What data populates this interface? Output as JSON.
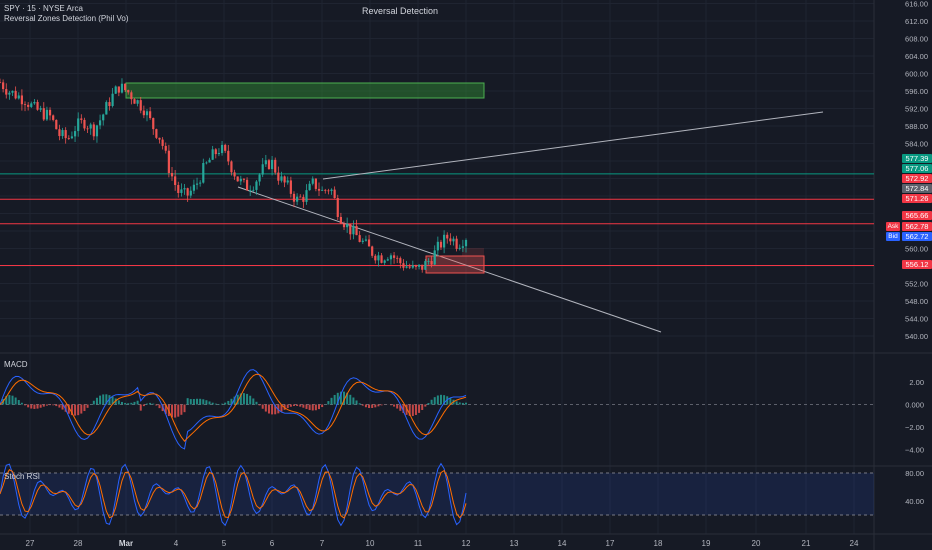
{
  "header": {
    "symbol_line": "SPY · 15 · NYSE Arca",
    "indicator_line": "Reversal Zones Detection (Phil Vo)",
    "chart_title": "Reversal Detection"
  },
  "panes": {
    "macd_label": "MACD",
    "stoch_label": "Stoch RSI"
  },
  "price_axis": {
    "ticks": [
      "616.00",
      "612.00",
      "608.00",
      "604.00",
      "600.00",
      "596.00",
      "592.00",
      "588.00",
      "584.00",
      "560.00",
      "552.00",
      "548.00",
      "544.00",
      "540.00"
    ]
  },
  "price_tags": [
    {
      "id": "t1",
      "text": "577.39",
      "color": "#089981"
    },
    {
      "id": "t2",
      "text": "577.06",
      "color": "#089981"
    },
    {
      "id": "t3",
      "text": "572.92",
      "color": "#f23645"
    },
    {
      "id": "t4",
      "text": "572.84",
      "color": "#5d606b"
    },
    {
      "id": "t5",
      "text": "571.26",
      "color": "#f23645"
    },
    {
      "id": "t6",
      "text": "565.66",
      "color": "#f23645"
    },
    {
      "id": "t7",
      "text": "562.78",
      "color": "#f23645"
    },
    {
      "id": "t8",
      "text": "562.72",
      "color": "#2962ff"
    },
    {
      "id": "t9",
      "text": "556.12",
      "color": "#f23645"
    }
  ],
  "ask_label": "Ask",
  "bid_label": "Bid",
  "macd_axis": [
    "2.00",
    "0.000",
    "−2.00",
    "−4.00"
  ],
  "stoch_axis": [
    "80.00",
    "40.00"
  ],
  "time_axis": [
    "27",
    "28",
    "Mar",
    "4",
    "5",
    "6",
    "7",
    "10",
    "11",
    "12",
    "13",
    "14",
    "17",
    "18",
    "19",
    "20",
    "21",
    "24"
  ],
  "colors": {
    "background": "#161a25",
    "up": "#26a69a",
    "down": "#ef5350",
    "zone_green": "#2e7d32",
    "resistance": "#f23645",
    "support": "#089981",
    "trendline": "#b2b5be",
    "macd_line": "#2962ff",
    "signal_line": "#ff6d00",
    "stoch_k": "#2962ff",
    "stoch_d": "#ff6d00",
    "stoch_band": "#2962ff"
  },
  "chart_data": {
    "type": "candlestick",
    "symbol": "SPY",
    "interval": "15",
    "price_range": [
      538,
      618
    ],
    "levels": [
      577.06,
      571.26,
      565.66,
      556.12
    ],
    "close_approx": 562.75,
    "series_price_path": [
      598,
      596,
      595,
      594,
      592,
      591,
      590,
      586,
      585,
      588,
      589,
      587,
      590,
      594,
      597,
      596,
      594,
      592,
      588,
      585,
      578,
      573,
      572,
      574,
      578,
      581,
      583,
      580,
      576,
      574,
      575,
      578,
      580,
      576,
      574,
      571,
      572,
      575,
      573,
      574,
      568,
      565,
      563,
      561,
      559,
      558,
      559,
      557,
      556,
      555,
      556,
      558,
      561,
      563,
      561,
      562.75
    ],
    "macd_range": [
      -5,
      3
    ],
    "stoch_range": [
      0,
      100
    ],
    "stoch_band": [
      20,
      80
    ]
  }
}
